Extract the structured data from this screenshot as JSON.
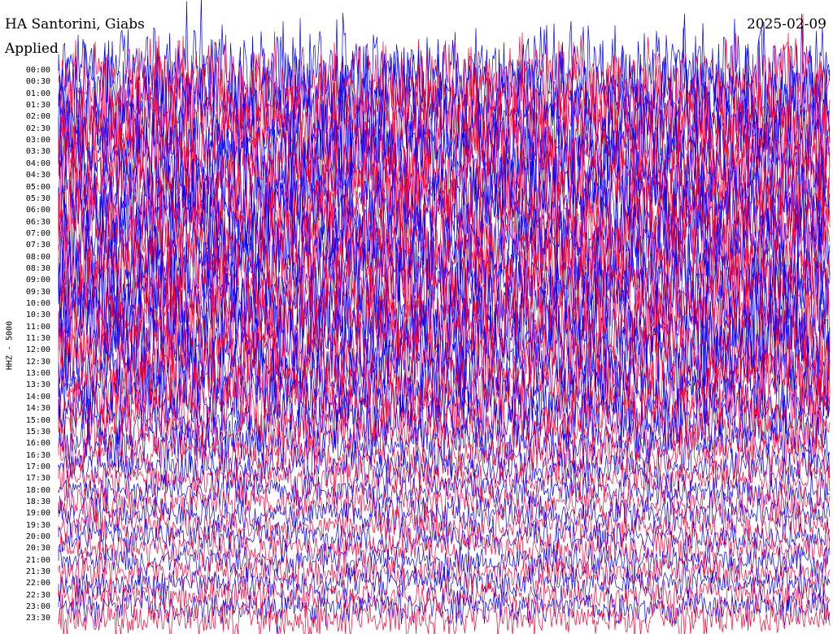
{
  "header": {
    "title": "HA Santorini, Giabs",
    "subtitle": "Applied",
    "date": "2025-02-09"
  },
  "chart_data": {
    "type": "line",
    "title": "HA Santorini, Giabs",
    "ylabel": "HHZ - 5000",
    "x": [
      "00:00",
      "00:30",
      "01:00",
      "01:30",
      "02:00",
      "02:30",
      "03:00",
      "03:30",
      "04:00",
      "04:30",
      "05:00",
      "05:30",
      "06:00",
      "06:30",
      "07:00",
      "07:30",
      "08:00",
      "08:30",
      "09:00",
      "09:30",
      "10:00",
      "10:30",
      "11:00",
      "11:30",
      "12:00",
      "12:30",
      "13:00",
      "13:30",
      "14:00",
      "14:30",
      "15:00",
      "15:30",
      "16:00",
      "16:30",
      "17:00",
      "17:30",
      "18:00",
      "18:30",
      "19:00",
      "19:30",
      "20:00",
      "20:30",
      "21:00",
      "21:30",
      "22:00",
      "22:30",
      "23:00",
      "23:30"
    ],
    "series": [
      {
        "color": "#0000ff"
      },
      {
        "color": "#ff0033"
      }
    ],
    "row_amplitude": [
      1.0,
      1.0,
      1.0,
      1.0,
      1.0,
      1.0,
      1.0,
      1.0,
      1.0,
      1.0,
      1.0,
      1.0,
      1.0,
      1.0,
      1.0,
      1.0,
      1.0,
      1.0,
      1.0,
      1.0,
      1.0,
      1.0,
      1.0,
      1.0,
      0.95,
      0.9,
      0.85,
      0.8,
      0.75,
      0.7,
      0.65,
      0.6,
      0.5,
      0.45,
      0.4,
      0.4,
      0.38,
      0.38,
      0.36,
      0.36,
      0.35,
      0.35,
      0.35,
      0.35,
      0.35,
      0.35,
      0.35,
      0.4
    ],
    "grid": false,
    "legend": "none"
  }
}
